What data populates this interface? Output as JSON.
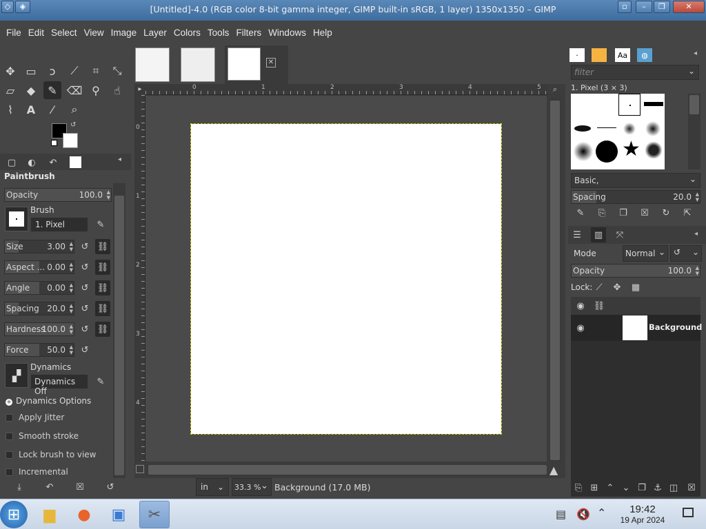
{
  "window": {
    "title": "[Untitled]-4.0 (RGB color 8-bit gamma integer, GIMP built-in sRGB, 1 layer) 1350x1350 – GIMP",
    "minimize": "–",
    "maximize": "❐",
    "close": "✕",
    "restore": "▫"
  },
  "menubar": [
    "File",
    "Edit",
    "Select",
    "View",
    "Image",
    "Layer",
    "Colors",
    "Tools",
    "Filters",
    "Windows",
    "Help"
  ],
  "tool_options": {
    "title": "Paintbrush",
    "opacity": {
      "label": "Opacity",
      "value": "100.0"
    },
    "brush": {
      "label": "Brush",
      "value": "1. Pixel"
    },
    "size": {
      "label": "Size",
      "value": "3.00"
    },
    "aspect": {
      "label": "Aspect ...",
      "value": "0.00"
    },
    "angle": {
      "label": "Angle",
      "value": "0.00"
    },
    "spacing": {
      "label": "Spacing",
      "value": "20.0"
    },
    "hardness": {
      "label": "Hardness",
      "value": "100.0"
    },
    "force": {
      "label": "Force",
      "value": "50.0"
    },
    "dynamics": {
      "label": "Dynamics",
      "value": "Dynamics Off"
    },
    "dynamics_options": "Dynamics Options",
    "checks": [
      "Apply Jitter",
      "Smooth stroke",
      "Lock brush to view",
      "Incremental"
    ]
  },
  "rulers": {
    "h": [
      "0",
      "1",
      "2",
      "3",
      "4",
      "5"
    ],
    "v": [
      "0",
      "1",
      "2",
      "3",
      "4"
    ]
  },
  "status": {
    "unit": "in",
    "zoom": "33.3 %",
    "layer_info": "Background (17.0 MB)"
  },
  "brushes_panel": {
    "filter_placeholder": "filter",
    "brush_name": "1. Pixel (3 × 3)",
    "preset": "Basic,",
    "spacing": {
      "label": "Spacing",
      "value": "20.0"
    }
  },
  "layers_panel": {
    "mode_label": "Mode",
    "mode_value": "Normal",
    "opacity": {
      "label": "Opacity",
      "value": "100.0"
    },
    "lock_label": "Lock:",
    "layer_name": "Background"
  },
  "taskbar": {
    "time": "19:42",
    "date": "19 Apr 2024"
  },
  "colors": {
    "fg": "#000000",
    "bg": "#ffffff",
    "accent": "#5a88b8"
  }
}
